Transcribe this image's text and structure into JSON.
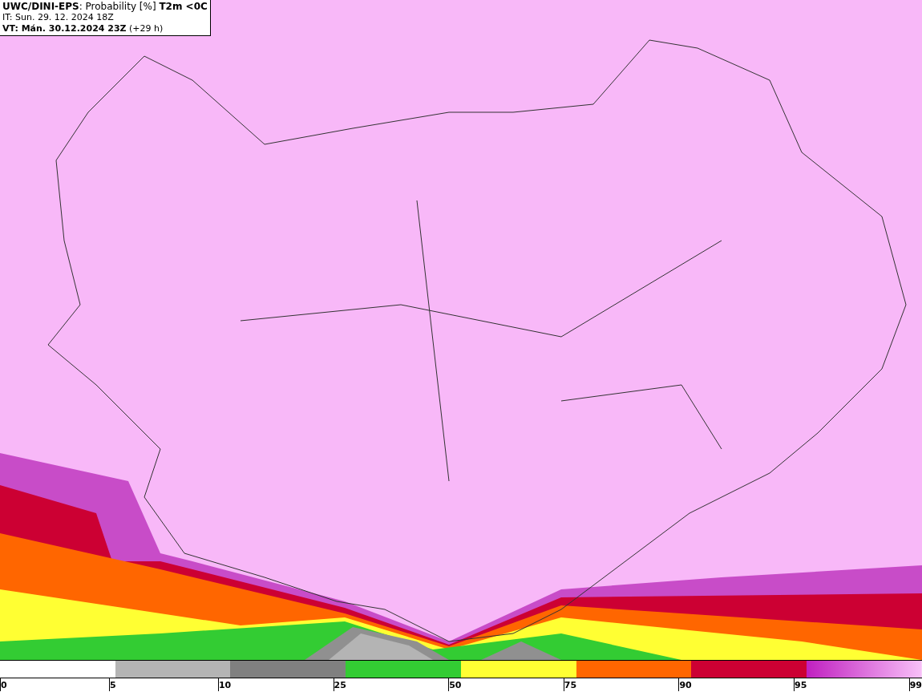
{
  "header": {
    "lines": [
      "**UWC/DINI-EPS**: Probability [%] **T2m <0C**",
      "IT: Sun. 29. 12. 2024 18Z",
      "**VT: Mán. 30.12.2024 23Z** (+29 h)"
    ]
  },
  "legend": {
    "ticks": [
      "0",
      "5",
      "10",
      "25",
      "50",
      "75",
      "90",
      "95",
      "99"
    ]
  }
}
